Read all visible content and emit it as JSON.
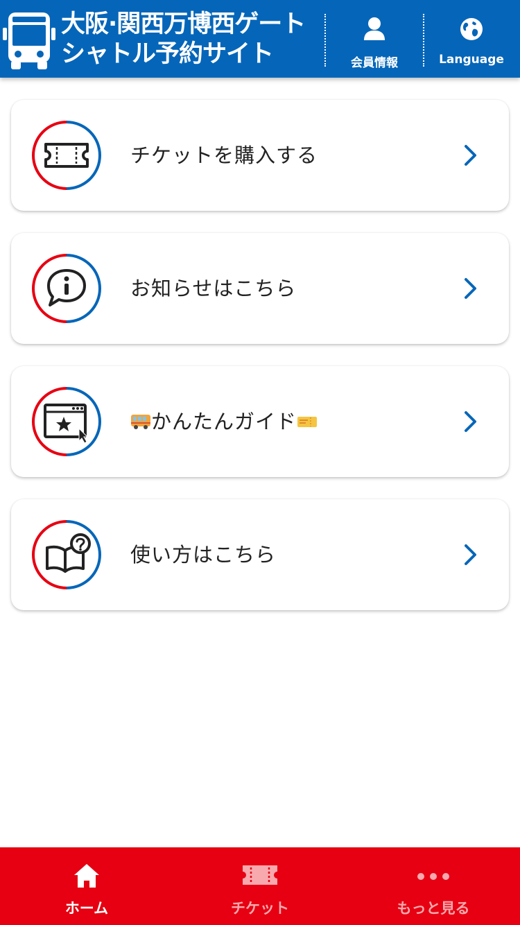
{
  "header": {
    "title_line1": "大阪·関西万博西ゲート",
    "title_line2": "シャトル予約サイト",
    "member_label": "会員情報",
    "language_label": "Language",
    "background_color": "#0566b9"
  },
  "menu": {
    "items": [
      {
        "label": "チケットを購入する",
        "icon": "ticket-icon"
      },
      {
        "label": "お知らせはこちら",
        "icon": "info-speech-bubble-icon"
      },
      {
        "label": "かんたんガイド",
        "icon": "browser-star-icon",
        "emoji_before": "bus-emoji",
        "emoji_after": "ticket-emoji"
      },
      {
        "label": "使い方はこちら",
        "icon": "book-question-icon"
      }
    ],
    "ring_colors": [
      "#e60012",
      "#0566b9"
    ],
    "chevron_color": "#0566b9"
  },
  "bottom_nav": {
    "background_color": "#e60012",
    "items": [
      {
        "label": "ホーム",
        "icon": "home-icon",
        "active": true
      },
      {
        "label": "チケット",
        "icon": "ticket-icon",
        "active": false
      },
      {
        "label": "もっと見る",
        "icon": "more-dots-icon",
        "active": false
      }
    ]
  }
}
